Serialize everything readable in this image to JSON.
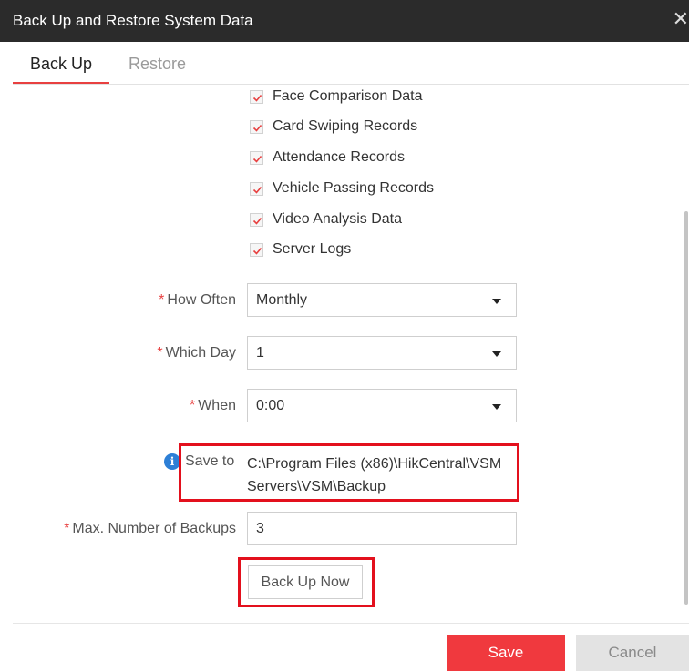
{
  "window": {
    "title": "Back Up and Restore System Data",
    "close_icon": "close-icon"
  },
  "tabs": {
    "backup": "Back Up",
    "restore": "Restore",
    "active": "Back Up"
  },
  "checkboxes": [
    {
      "label": "Face Comparison Data",
      "checked": true
    },
    {
      "label": "Card Swiping Records",
      "checked": true
    },
    {
      "label": "Attendance Records",
      "checked": true
    },
    {
      "label": "Vehicle Passing Records",
      "checked": true
    },
    {
      "label": "Video Analysis Data",
      "checked": true
    },
    {
      "label": "Server Logs",
      "checked": true
    }
  ],
  "form": {
    "required_mark": "*",
    "how_often": {
      "label": "How Often",
      "value": "Monthly"
    },
    "which_day": {
      "label": "Which Day",
      "value": "1"
    },
    "when": {
      "label": "When",
      "value": "0:00"
    },
    "save_to": {
      "label": "Save to",
      "path": "C:\\Program Files (x86)\\HikCentral\\VSM Servers\\VSM\\Backup"
    },
    "max_backups": {
      "label": "Max. Number of Backups",
      "value": "3"
    },
    "back_up_now": "Back Up Now"
  },
  "footer": {
    "save": "Save",
    "cancel": "Cancel"
  },
  "colors": {
    "accent": "#e84040",
    "highlight": "#e3101d",
    "save_button": "#f0393e",
    "info": "#2d7fd6",
    "titlebar": "#2b2b2b"
  }
}
